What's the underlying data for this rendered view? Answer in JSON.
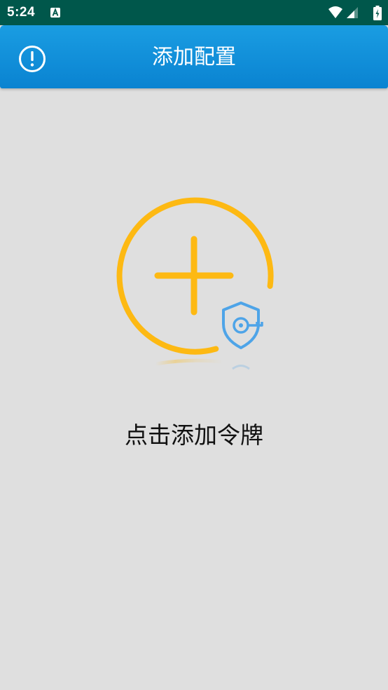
{
  "status_bar": {
    "time": "5:24",
    "icons": [
      "text-a-notification-icon",
      "wifi-icon",
      "cell-signal-icon",
      "battery-charging-icon"
    ]
  },
  "app_bar": {
    "title": "添加配置",
    "info_icon": "exclamation-circle-icon"
  },
  "main": {
    "add_token_icon": "plus-circle-shield-key-icon",
    "add_token_label": "点击添加令牌"
  },
  "colors": {
    "status_bar": "#00574b",
    "app_bar": "#1a9de2",
    "background": "#dfdfdf",
    "accent_yellow": "#fdb913",
    "shield_blue": "#4ea4e8"
  }
}
